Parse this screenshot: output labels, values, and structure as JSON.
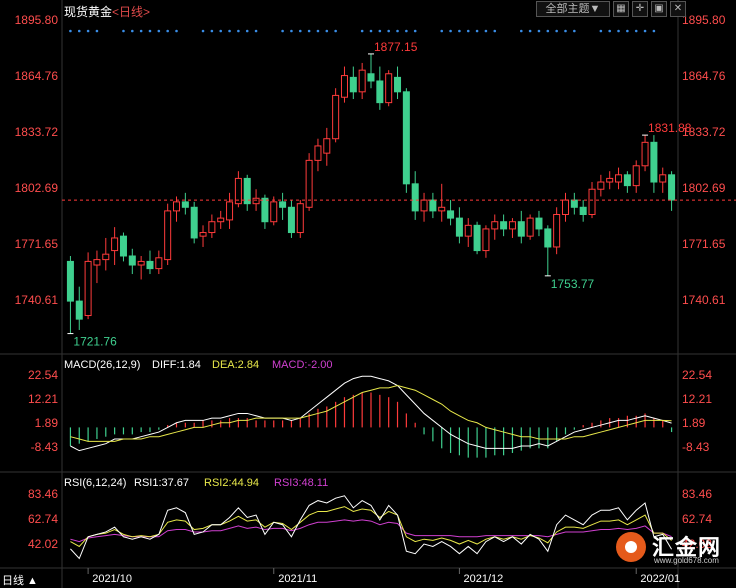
{
  "header": {
    "instrument": "现货黄金",
    "period": "<日线>",
    "theme_selector": "全部主题▼",
    "icons": [
      "grid-icon",
      "crosshair-icon",
      "restore-icon",
      "close-icon"
    ]
  },
  "price_axis": [
    "1895.80",
    "1864.76",
    "1833.72",
    "1802.69",
    "1771.65",
    "1740.61"
  ],
  "price_annotations": {
    "high1": "1877.15",
    "high2": "1831.88",
    "low1": "1721.76",
    "low2": "1753.77"
  },
  "macd": {
    "label": "MACD(26,12,9)",
    "diff": "DIFF:1.84",
    "dea": "DEA:2.84",
    "macd": "MACD:-2.00",
    "axis": [
      "22.54",
      "12.21",
      "1.89",
      "-8.43"
    ]
  },
  "rsi": {
    "label": "RSI(6,12,24)",
    "rsi1": "RSI1:37.67",
    "rsi2": "RSI2:44.94",
    "rsi3": "RSI3:48.11",
    "axis": [
      "83.46",
      "62.74",
      "42.02"
    ]
  },
  "dates": [
    "2021/10",
    "2021/11",
    "2021/12",
    "2022/01"
  ],
  "bottom_left": "日线 ▲",
  "logo": {
    "name": "汇金网",
    "url": "www.gold678.com"
  },
  "colors": {
    "up": "#ff3b3b",
    "down": "#3fd08f",
    "white": "#ffffff",
    "yellow": "#e8e84a",
    "magenta": "#d040d0",
    "blue": "#3a8ee8",
    "axis_red": "#ff4d4d"
  },
  "chart_data": {
    "type": "candlestick",
    "title": "现货黄金 <日线>",
    "ylim": [
      1715,
      1900
    ],
    "candles": [
      [
        1762.0,
        1765.0,
        1722.0,
        1740.0
      ],
      [
        1740.0,
        1748.0,
        1724.0,
        1730.0
      ],
      [
        1732.0,
        1767.0,
        1730.0,
        1762.0
      ],
      [
        1760.0,
        1768.0,
        1750.0,
        1763.0
      ],
      [
        1763.0,
        1775.0,
        1757.0,
        1766.0
      ],
      [
        1768.0,
        1781.0,
        1760.0,
        1775.0
      ],
      [
        1776.0,
        1778.0,
        1762.0,
        1765.0
      ],
      [
        1765.0,
        1769.0,
        1755.0,
        1760.0
      ],
      [
        1760.0,
        1765.0,
        1752.0,
        1762.0
      ],
      [
        1762.0,
        1768.0,
        1755.0,
        1758.0
      ],
      [
        1758.0,
        1768.0,
        1755.0,
        1764.0
      ],
      [
        1763.0,
        1794.0,
        1760.0,
        1790.0
      ],
      [
        1790.0,
        1798.0,
        1784.0,
        1795.0
      ],
      [
        1795.0,
        1800.0,
        1788.0,
        1792.0
      ],
      [
        1792.0,
        1795.0,
        1772.0,
        1775.0
      ],
      [
        1776.0,
        1782.0,
        1770.0,
        1778.0
      ],
      [
        1778.0,
        1788.0,
        1775.0,
        1784.0
      ],
      [
        1784.0,
        1790.0,
        1780.0,
        1786.0
      ],
      [
        1785.0,
        1800.0,
        1780.0,
        1795.0
      ],
      [
        1794.0,
        1812.0,
        1792.0,
        1808.0
      ],
      [
        1808.0,
        1810.0,
        1790.0,
        1794.0
      ],
      [
        1794.0,
        1802.0,
        1790.0,
        1797.0
      ],
      [
        1797.0,
        1799.0,
        1780.0,
        1784.0
      ],
      [
        1784.0,
        1798.0,
        1782.0,
        1795.0
      ],
      [
        1795.0,
        1800.0,
        1785.0,
        1792.0
      ],
      [
        1792.0,
        1796.0,
        1775.0,
        1778.0
      ],
      [
        1778.0,
        1796.0,
        1775.0,
        1794.0
      ],
      [
        1792.0,
        1822.0,
        1790.0,
        1818.0
      ],
      [
        1818.0,
        1830.0,
        1812.0,
        1826.0
      ],
      [
        1822.0,
        1836.0,
        1815.0,
        1830.0
      ],
      [
        1830.0,
        1858.0,
        1828.0,
        1854.0
      ],
      [
        1853.0,
        1870.0,
        1850.0,
        1865.0
      ],
      [
        1864.0,
        1870.0,
        1852.0,
        1856.0
      ],
      [
        1856.0,
        1872.0,
        1852.0,
        1868.0
      ],
      [
        1866.0,
        1877.0,
        1858.0,
        1862.0
      ],
      [
        1862.0,
        1870.0,
        1846.0,
        1850.0
      ],
      [
        1850.0,
        1868.0,
        1848.0,
        1866.0
      ],
      [
        1864.0,
        1870.0,
        1852.0,
        1856.0
      ],
      [
        1856.0,
        1858.0,
        1800.0,
        1805.0
      ],
      [
        1805.0,
        1812.0,
        1785.0,
        1790.0
      ],
      [
        1790.0,
        1800.0,
        1784.0,
        1796.0
      ],
      [
        1796.0,
        1800.0,
        1786.0,
        1790.0
      ],
      [
        1790.0,
        1805.0,
        1784.0,
        1792.0
      ],
      [
        1790.0,
        1796.0,
        1782.0,
        1786.0
      ],
      [
        1786.0,
        1792.0,
        1772.0,
        1776.0
      ],
      [
        1776.0,
        1786.0,
        1770.0,
        1782.0
      ],
      [
        1782.0,
        1784.0,
        1766.0,
        1768.0
      ],
      [
        1768.0,
        1782.0,
        1764.0,
        1780.0
      ],
      [
        1780.0,
        1788.0,
        1774.0,
        1784.0
      ],
      [
        1784.0,
        1788.0,
        1776.0,
        1780.0
      ],
      [
        1780.0,
        1786.0,
        1775.0,
        1784.0
      ],
      [
        1784.0,
        1790.0,
        1772.0,
        1776.0
      ],
      [
        1776.0,
        1788.0,
        1774.0,
        1786.0
      ],
      [
        1786.0,
        1790.0,
        1776.0,
        1780.0
      ],
      [
        1780.0,
        1782.0,
        1754.0,
        1770.0
      ],
      [
        1770.0,
        1792.0,
        1766.0,
        1788.0
      ],
      [
        1788.0,
        1800.0,
        1784.0,
        1796.0
      ],
      [
        1796.0,
        1800.0,
        1788.0,
        1792.0
      ],
      [
        1792.0,
        1796.0,
        1784.0,
        1788.0
      ],
      [
        1788.0,
        1806.0,
        1786.0,
        1802.0
      ],
      [
        1802.0,
        1810.0,
        1798.0,
        1806.0
      ],
      [
        1806.0,
        1812.0,
        1802.0,
        1808.0
      ],
      [
        1806.0,
        1814.0,
        1802.0,
        1810.0
      ],
      [
        1810.0,
        1812.0,
        1800.0,
        1804.0
      ],
      [
        1804.0,
        1818.0,
        1800.0,
        1815.0
      ],
      [
        1815.0,
        1832.0,
        1812.0,
        1828.0
      ],
      [
        1828.0,
        1832.0,
        1800.0,
        1806.0
      ],
      [
        1806.0,
        1814.0,
        1800.0,
        1810.0
      ],
      [
        1810.0,
        1812.0,
        1790.0,
        1796.0
      ]
    ],
    "last_price_line": 1796.0,
    "macd_hist": [
      -8,
      -7,
      -6,
      -5,
      -4,
      -3,
      -3,
      -3,
      -2,
      -2,
      -1,
      1,
      2,
      2,
      2,
      3,
      3,
      3,
      4,
      4,
      4,
      3,
      3,
      3,
      3,
      3,
      4,
      6,
      8,
      9,
      11,
      13,
      14,
      15,
      15,
      14,
      13,
      11,
      6,
      2,
      -3,
      -6,
      -9,
      -11,
      -12,
      -13,
      -13,
      -13,
      -12,
      -12,
      -11,
      -10,
      -9,
      -9,
      -9,
      -6,
      -3,
      -1,
      1,
      2,
      3,
      4,
      4,
      5,
      5,
      6,
      4,
      3,
      -2
    ],
    "macd_diff": [
      -8,
      -10,
      -9,
      -8,
      -7,
      -5,
      -5,
      -5,
      -4,
      -3,
      -2,
      0,
      2,
      3,
      3,
      3,
      4,
      4,
      5,
      6,
      6,
      5,
      4,
      4,
      4,
      3,
      4,
      7,
      10,
      13,
      16,
      19,
      21,
      22,
      22,
      21,
      20,
      18,
      14,
      10,
      6,
      3,
      0,
      -3,
      -5,
      -7,
      -8,
      -9,
      -9,
      -9,
      -9,
      -8,
      -8,
      -7,
      -8,
      -6,
      -4,
      -2,
      -1,
      0,
      1,
      2,
      3,
      3,
      4,
      5,
      4,
      3,
      1.84
    ],
    "macd_dea": [
      -4,
      -5,
      -6,
      -6,
      -6,
      -6,
      -5,
      -5,
      -5,
      -4,
      -4,
      -3,
      -2,
      -1,
      0,
      0,
      1,
      2,
      2,
      3,
      3,
      4,
      4,
      4,
      4,
      4,
      4,
      5,
      6,
      7,
      9,
      11,
      13,
      15,
      16,
      17,
      17,
      18,
      17,
      16,
      14,
      12,
      10,
      7,
      5,
      3,
      2,
      0,
      -1,
      -2,
      -3,
      -4,
      -4,
      -5,
      -5,
      -5,
      -5,
      -4,
      -4,
      -3,
      -2,
      -1,
      0,
      1,
      2,
      3,
      3,
      3,
      2.84
    ],
    "rsi1": [
      38,
      30,
      48,
      50,
      52,
      56,
      48,
      46,
      48,
      46,
      50,
      70,
      72,
      68,
      50,
      52,
      58,
      58,
      64,
      72,
      64,
      66,
      50,
      60,
      58,
      48,
      62,
      74,
      78,
      76,
      80,
      82,
      72,
      78,
      74,
      62,
      74,
      66,
      36,
      34,
      42,
      40,
      44,
      40,
      34,
      40,
      34,
      44,
      48,
      44,
      48,
      42,
      50,
      46,
      36,
      58,
      66,
      62,
      58,
      66,
      70,
      70,
      72,
      62,
      70,
      76,
      48,
      50,
      37.67
    ],
    "rsi2": [
      44,
      40,
      48,
      50,
      51,
      54,
      50,
      48,
      49,
      48,
      50,
      60,
      62,
      61,
      54,
      55,
      58,
      58,
      61,
      65,
      61,
      62,
      56,
      60,
      59,
      54,
      60,
      66,
      69,
      69,
      71,
      73,
      69,
      71,
      70,
      64,
      69,
      66,
      48,
      44,
      46,
      45,
      47,
      45,
      42,
      45,
      42,
      46,
      48,
      46,
      48,
      46,
      49,
      47,
      43,
      52,
      56,
      56,
      55,
      58,
      61,
      61,
      62,
      58,
      62,
      66,
      51,
      51,
      44.94
    ],
    "rsi3": [
      46,
      44,
      47,
      48,
      49,
      50,
      49,
      48,
      48,
      48,
      48,
      53,
      54,
      54,
      52,
      52,
      53,
      53,
      55,
      57,
      55,
      56,
      54,
      55,
      55,
      53,
      55,
      58,
      60,
      60,
      61,
      62,
      61,
      62,
      61,
      58,
      60,
      59,
      51,
      49,
      49,
      49,
      49,
      49,
      48,
      48,
      48,
      49,
      49,
      49,
      49,
      49,
      49,
      49,
      48,
      50,
      52,
      52,
      52,
      53,
      54,
      54,
      55,
      54,
      55,
      57,
      51,
      51,
      48.11
    ]
  }
}
